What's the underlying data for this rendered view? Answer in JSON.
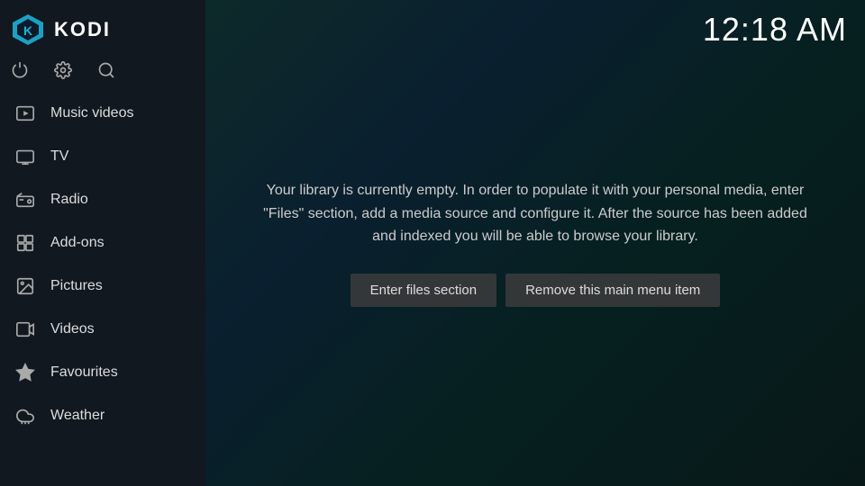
{
  "app": {
    "name": "KODI",
    "clock": "12:18 AM"
  },
  "toolbar": {
    "power_icon": "⏻",
    "settings_icon": "⚙",
    "search_icon": "🔍"
  },
  "sidebar": {
    "items": [
      {
        "id": "music-videos",
        "label": "Music videos"
      },
      {
        "id": "tv",
        "label": "TV"
      },
      {
        "id": "radio",
        "label": "Radio"
      },
      {
        "id": "add-ons",
        "label": "Add-ons"
      },
      {
        "id": "pictures",
        "label": "Pictures"
      },
      {
        "id": "videos",
        "label": "Videos"
      },
      {
        "id": "favourites",
        "label": "Favourites"
      },
      {
        "id": "weather",
        "label": "Weather"
      }
    ]
  },
  "main": {
    "empty_message": "Your library is currently empty. In order to populate it with your personal media, enter \"Files\" section, add a media source and configure it. After the source has been added and indexed you will be able to browse your library.",
    "btn_enter_files": "Enter files section",
    "btn_remove_menu": "Remove this main menu item"
  }
}
